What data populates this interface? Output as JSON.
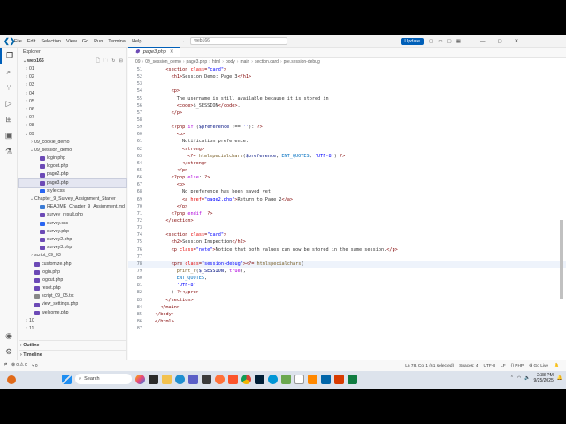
{
  "titlebar": {
    "menu": [
      "File",
      "Edit",
      "Selection",
      "View",
      "Go",
      "Run",
      "Terminal",
      "Help"
    ],
    "search": "web166",
    "update_label": "Update"
  },
  "sidebar": {
    "explorer_label": "Explorer",
    "root_label": "web166",
    "items": [
      {
        "label": "01",
        "depth": 1,
        "type": "folder",
        "open": false
      },
      {
        "label": "02",
        "depth": 1,
        "type": "folder",
        "open": false
      },
      {
        "label": "03",
        "depth": 1,
        "type": "folder",
        "open": false
      },
      {
        "label": "04",
        "depth": 1,
        "type": "folder",
        "open": false
      },
      {
        "label": "05",
        "depth": 1,
        "type": "folder",
        "open": false
      },
      {
        "label": "06",
        "depth": 1,
        "type": "folder",
        "open": false
      },
      {
        "label": "07",
        "depth": 1,
        "type": "folder",
        "open": false
      },
      {
        "label": "08",
        "depth": 1,
        "type": "folder",
        "open": false
      },
      {
        "label": "09",
        "depth": 1,
        "type": "folder",
        "open": true
      },
      {
        "label": "09_cookie_demo",
        "depth": 2,
        "type": "folder",
        "open": false
      },
      {
        "label": "09_session_demo",
        "depth": 2,
        "type": "folder",
        "open": true
      },
      {
        "label": "login.php",
        "depth": 3,
        "type": "php"
      },
      {
        "label": "logout.php",
        "depth": 3,
        "type": "php"
      },
      {
        "label": "page2.php",
        "depth": 3,
        "type": "php"
      },
      {
        "label": "page3.php",
        "depth": 3,
        "type": "php",
        "selected": true
      },
      {
        "label": "style.css",
        "depth": 3,
        "type": "css"
      },
      {
        "label": "Chapter_9_Survey_Assignment_Starter",
        "depth": 2,
        "type": "folder",
        "open": true
      },
      {
        "label": "README_Chapter_9_Assignment.md",
        "depth": 3,
        "type": "md"
      },
      {
        "label": "survey_result.php",
        "depth": 3,
        "type": "php"
      },
      {
        "label": "survey.css",
        "depth": 3,
        "type": "css"
      },
      {
        "label": "survey.php",
        "depth": 3,
        "type": "php"
      },
      {
        "label": "survey2.php",
        "depth": 3,
        "type": "php"
      },
      {
        "label": "survey3.php",
        "depth": 3,
        "type": "php"
      },
      {
        "label": "script_09_03",
        "depth": 2,
        "type": "folder",
        "open": false
      },
      {
        "label": "customize.php",
        "depth": 2,
        "type": "php"
      },
      {
        "label": "login.php",
        "depth": 2,
        "type": "php"
      },
      {
        "label": "logout.php",
        "depth": 2,
        "type": "php"
      },
      {
        "label": "reset.php",
        "depth": 2,
        "type": "php"
      },
      {
        "label": "script_09_05.txt",
        "depth": 2,
        "type": "txt"
      },
      {
        "label": "view_settings.php",
        "depth": 2,
        "type": "php"
      },
      {
        "label": "welcome.php",
        "depth": 2,
        "type": "php"
      },
      {
        "label": "10",
        "depth": 1,
        "type": "folder",
        "open": false
      },
      {
        "label": "11",
        "depth": 1,
        "type": "folder",
        "open": false
      }
    ],
    "outline_label": "Outline",
    "timeline_label": "Timeline"
  },
  "editor": {
    "tab_label": "page3.php",
    "breadcrumb": [
      "09",
      "09_session_demo",
      "page3.php",
      "html",
      "body",
      "main",
      "section.card",
      "pre.session-debug"
    ],
    "lines": [
      {
        "n": "51",
        "indent": 4,
        "segs": [
          [
            "tag",
            "<section "
          ],
          [
            "attr",
            "class"
          ],
          [
            "tag",
            "="
          ],
          [
            "str",
            "\"card\""
          ],
          [
            "tag",
            ">"
          ]
        ]
      },
      {
        "n": "52",
        "indent": 6,
        "segs": [
          [
            "tag",
            "<h1>"
          ],
          [
            "txt",
            "Session Demo: Page 3"
          ],
          [
            "tag",
            "</h1>"
          ]
        ]
      },
      {
        "n": "53",
        "indent": 0,
        "segs": []
      },
      {
        "n": "54",
        "indent": 6,
        "segs": [
          [
            "tag",
            "<p>"
          ]
        ]
      },
      {
        "n": "55",
        "indent": 8,
        "segs": [
          [
            "txt",
            "The username is still available because it is stored in"
          ]
        ]
      },
      {
        "n": "56",
        "indent": 8,
        "segs": [
          [
            "tag",
            "<code>"
          ],
          [
            "txt",
            "$_SESSION"
          ],
          [
            "tag",
            "</code>"
          ],
          [
            "txt",
            "."
          ]
        ]
      },
      {
        "n": "57",
        "indent": 6,
        "segs": [
          [
            "tag",
            "</p>"
          ]
        ]
      },
      {
        "n": "58",
        "indent": 0,
        "segs": []
      },
      {
        "n": "59",
        "indent": 6,
        "segs": [
          [
            "php",
            "<?php "
          ],
          [
            "kw",
            "if"
          ],
          [
            "txt",
            " ("
          ],
          [
            "var",
            "$preference"
          ],
          [
            "txt",
            " !== "
          ],
          [
            "str",
            "''"
          ],
          [
            "txt",
            "): "
          ],
          [
            "php",
            "?>"
          ]
        ]
      },
      {
        "n": "60",
        "indent": 8,
        "segs": [
          [
            "tag",
            "<p>"
          ]
        ]
      },
      {
        "n": "61",
        "indent": 10,
        "segs": [
          [
            "txt",
            "Notification preference:"
          ]
        ]
      },
      {
        "n": "62",
        "indent": 10,
        "segs": [
          [
            "tag",
            "<strong>"
          ]
        ]
      },
      {
        "n": "63",
        "indent": 12,
        "segs": [
          [
            "php",
            "<?= "
          ],
          [
            "fn",
            "htmlspecialchars"
          ],
          [
            "txt",
            "("
          ],
          [
            "var",
            "$preference"
          ],
          [
            "txt",
            ", "
          ],
          [
            "const",
            "ENT_QUOTES"
          ],
          [
            "txt",
            ", "
          ],
          [
            "str",
            "'UTF-8'"
          ],
          [
            "txt",
            ") "
          ],
          [
            "php",
            "?>"
          ]
        ]
      },
      {
        "n": "64",
        "indent": 10,
        "segs": [
          [
            "tag",
            "</strong>"
          ]
        ]
      },
      {
        "n": "65",
        "indent": 8,
        "segs": [
          [
            "tag",
            "</p>"
          ]
        ]
      },
      {
        "n": "66",
        "indent": 6,
        "segs": [
          [
            "php",
            "<?php "
          ],
          [
            "kw",
            "else"
          ],
          [
            "txt",
            ": "
          ],
          [
            "php",
            "?>"
          ]
        ]
      },
      {
        "n": "67",
        "indent": 8,
        "segs": [
          [
            "tag",
            "<p>"
          ]
        ]
      },
      {
        "n": "68",
        "indent": 10,
        "segs": [
          [
            "txt",
            "No preference has been saved yet."
          ]
        ]
      },
      {
        "n": "69",
        "indent": 10,
        "segs": [
          [
            "tag",
            "<a "
          ],
          [
            "attr",
            "href"
          ],
          [
            "tag",
            "="
          ],
          [
            "str",
            "\"page2.php\""
          ],
          [
            "tag",
            ">"
          ],
          [
            "txt",
            "Return to Page 2"
          ],
          [
            "tag",
            "</a>"
          ],
          [
            "txt",
            "."
          ]
        ]
      },
      {
        "n": "70",
        "indent": 8,
        "segs": [
          [
            "tag",
            "</p>"
          ]
        ]
      },
      {
        "n": "71",
        "indent": 6,
        "segs": [
          [
            "php",
            "<?php "
          ],
          [
            "kw",
            "endif"
          ],
          [
            "txt",
            "; "
          ],
          [
            "php",
            "?>"
          ]
        ]
      },
      {
        "n": "72",
        "indent": 4,
        "segs": [
          [
            "tag",
            "</section>"
          ]
        ]
      },
      {
        "n": "73",
        "indent": 0,
        "segs": []
      },
      {
        "n": "74",
        "indent": 4,
        "segs": [
          [
            "tag",
            "<section "
          ],
          [
            "attr",
            "class"
          ],
          [
            "tag",
            "="
          ],
          [
            "str",
            "\"card\""
          ],
          [
            "tag",
            ">"
          ]
        ]
      },
      {
        "n": "75",
        "indent": 6,
        "segs": [
          [
            "tag",
            "<h2>"
          ],
          [
            "txt",
            "Session Inspection"
          ],
          [
            "tag",
            "</h2>"
          ]
        ]
      },
      {
        "n": "76",
        "indent": 6,
        "segs": [
          [
            "tag",
            "<p "
          ],
          [
            "attr",
            "class"
          ],
          [
            "tag",
            "="
          ],
          [
            "str",
            "\"note\""
          ],
          [
            "tag",
            ">"
          ],
          [
            "txt",
            "Notice that both values can now be stored in the same session."
          ],
          [
            "tag",
            "</p>"
          ]
        ]
      },
      {
        "n": "77",
        "indent": 0,
        "segs": []
      },
      {
        "n": "78",
        "indent": 6,
        "hl": true,
        "segs": [
          [
            "tag",
            "<pre "
          ],
          [
            "attr",
            "class"
          ],
          [
            "tag",
            "="
          ],
          [
            "str",
            "\"session-debug\""
          ],
          [
            "tag",
            ">"
          ],
          [
            "php",
            "<?= "
          ],
          [
            "fn",
            "htmlspecialchars"
          ],
          [
            "txt",
            "("
          ]
        ]
      },
      {
        "n": "79",
        "indent": 8,
        "segs": [
          [
            "fn",
            "print_r"
          ],
          [
            "txt",
            "("
          ],
          [
            "var",
            "$_SESSION"
          ],
          [
            "txt",
            ", "
          ],
          [
            "kw",
            "true"
          ],
          [
            "txt",
            "),"
          ]
        ]
      },
      {
        "n": "80",
        "indent": 8,
        "segs": [
          [
            "const",
            "ENT_QUOTES"
          ],
          [
            "txt",
            ","
          ]
        ]
      },
      {
        "n": "81",
        "indent": 8,
        "segs": [
          [
            "str",
            "'UTF-8'"
          ]
        ]
      },
      {
        "n": "82",
        "indent": 6,
        "segs": [
          [
            "txt",
            ") "
          ],
          [
            "php",
            "?>"
          ],
          [
            "tag",
            "</pre>"
          ]
        ]
      },
      {
        "n": "83",
        "indent": 4,
        "segs": [
          [
            "tag",
            "</section>"
          ]
        ]
      },
      {
        "n": "84",
        "indent": 2,
        "segs": [
          [
            "tag",
            "</main>"
          ]
        ]
      },
      {
        "n": "85",
        "indent": 0,
        "segs": [
          [
            "tag",
            "</body>"
          ]
        ]
      },
      {
        "n": "86",
        "indent": 0,
        "segs": [
          [
            "tag",
            "</html>"
          ]
        ]
      },
      {
        "n": "87",
        "indent": 0,
        "segs": []
      }
    ]
  },
  "statusbar": {
    "left": [
      "⊗ 0 ⚠ 0",
      "⑂ 0"
    ],
    "right": [
      "Ln 78, Col 1 (61 selected)",
      "Spaces: 4",
      "UTF-8",
      "LF",
      "{} PHP",
      "⊕ Go Live"
    ]
  },
  "taskbar": {
    "search_label": "Search",
    "time": "2:38 PM",
    "date": "9/25/2025"
  },
  "colors": {
    "accent": "#005fb8",
    "selected_row": "#e4e6f1"
  }
}
